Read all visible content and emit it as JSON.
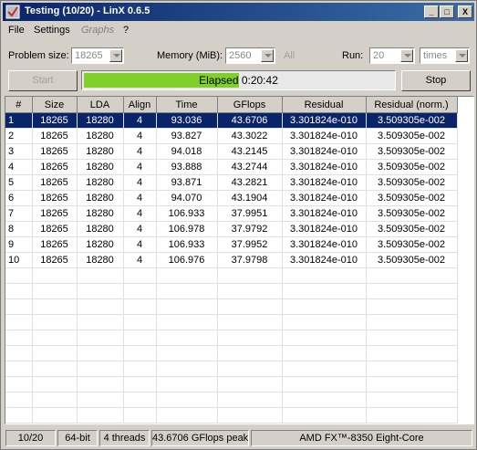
{
  "window": {
    "title": "Testing (10/20) - LinX 0.6.5",
    "minimize": "_",
    "maximize": "□",
    "close": "X"
  },
  "menu": {
    "file": "File",
    "settings": "Settings",
    "graphs": "Graphs",
    "help": "?"
  },
  "controls": {
    "problem_size_label": "Problem size:",
    "problem_size_value": "18265",
    "memory_label": "Memory (MiB):",
    "memory_value": "2560",
    "all_label": "All",
    "run_label": "Run:",
    "run_value": "20",
    "run_unit": "times",
    "start_label": "Start",
    "stop_label": "Stop",
    "progress_text": "Elapsed 0:20:42",
    "progress_fraction": 0.5
  },
  "table": {
    "columns": [
      "#",
      "Size",
      "LDA",
      "Align",
      "Time",
      "GFlops",
      "Residual",
      "Residual (norm.)"
    ],
    "rows": [
      [
        "1",
        "18265",
        "18280",
        "4",
        "93.036",
        "43.6706",
        "3.301824e-010",
        "3.509305e-002"
      ],
      [
        "2",
        "18265",
        "18280",
        "4",
        "93.827",
        "43.3022",
        "3.301824e-010",
        "3.509305e-002"
      ],
      [
        "3",
        "18265",
        "18280",
        "4",
        "94.018",
        "43.2145",
        "3.301824e-010",
        "3.509305e-002"
      ],
      [
        "4",
        "18265",
        "18280",
        "4",
        "93.888",
        "43.2744",
        "3.301824e-010",
        "3.509305e-002"
      ],
      [
        "5",
        "18265",
        "18280",
        "4",
        "93.871",
        "43.2821",
        "3.301824e-010",
        "3.509305e-002"
      ],
      [
        "6",
        "18265",
        "18280",
        "4",
        "94.070",
        "43.1904",
        "3.301824e-010",
        "3.509305e-002"
      ],
      [
        "7",
        "18265",
        "18280",
        "4",
        "106.933",
        "37.9951",
        "3.301824e-010",
        "3.509305e-002"
      ],
      [
        "8",
        "18265",
        "18280",
        "4",
        "106.978",
        "37.9792",
        "3.301824e-010",
        "3.509305e-002"
      ],
      [
        "9",
        "18265",
        "18280",
        "4",
        "106.933",
        "37.9952",
        "3.301824e-010",
        "3.509305e-002"
      ],
      [
        "10",
        "18265",
        "18280",
        "4",
        "106.976",
        "37.9798",
        "3.301824e-010",
        "3.509305e-002"
      ]
    ],
    "selected_row": 0
  },
  "status": {
    "progress": "10/20",
    "arch": "64-bit",
    "threads": "4 threads",
    "peak": "43.6706 GFlops peak",
    "cpu": "AMD FX™-8350 Eight-Core"
  },
  "colors": {
    "selection": "#0a246a",
    "progress_fill": "#7fd12a",
    "titlebar": "#0a246a"
  }
}
